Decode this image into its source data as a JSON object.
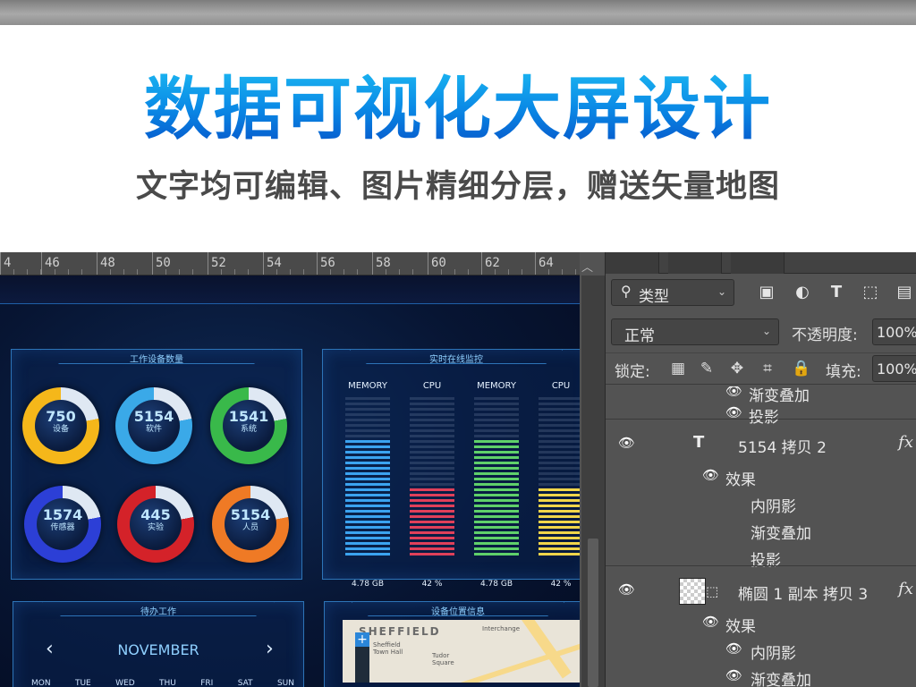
{
  "banner": {
    "title": "数据可视化大屏设计",
    "subtitle": "文字均可编辑、图片精细分层，赠送矢量地图"
  },
  "ruler": {
    "ticks": [
      "4",
      "46",
      "48",
      "50",
      "52",
      "54",
      "56",
      "58",
      "60",
      "62",
      "64"
    ]
  },
  "dashboard": {
    "panel_devices": {
      "title": "工作设备数量",
      "rings": [
        {
          "value": "750",
          "label": "设备",
          "color": "#f5b71a"
        },
        {
          "value": "5154",
          "label": "软件",
          "color": "#3aa9e8"
        },
        {
          "value": "1541",
          "label": "系统",
          "color": "#39b94a"
        },
        {
          "value": "1574",
          "label": "传感器",
          "color": "#2c3fd6"
        },
        {
          "value": "445",
          "label": "实验",
          "color": "#d42229"
        },
        {
          "value": "5154",
          "label": "人员",
          "color": "#ef7a25"
        }
      ]
    },
    "panel_monitor": {
      "title": "实时在线监控",
      "columns": [
        {
          "head": "MEMORY",
          "foot": "4.78 GB",
          "color": "#3ba3f0",
          "level": 0.72
        },
        {
          "head": "CPU",
          "foot": "42 %",
          "color": "#e0405a",
          "level": 0.42
        },
        {
          "head": "MEMORY",
          "foot": "4.78 GB",
          "color": "#5fd06a",
          "level": 0.72
        },
        {
          "head": "CPU",
          "foot": "42 %",
          "color": "#f1d54a",
          "level": 0.42
        }
      ]
    },
    "panel_calendar": {
      "title": "待办工作",
      "month": "NOVEMBER",
      "prev": "‹",
      "next": "›",
      "days": [
        "MON",
        "TUE",
        "WED",
        "THU",
        "FRI",
        "SAT",
        "SUN"
      ]
    },
    "panel_location": {
      "title": "设备位置信息",
      "map_name": "SHEFFIELD",
      "map_labels": [
        "Sheffield Town Hall",
        "Tudor Square",
        "Interchange"
      ],
      "zoom_in": "+"
    }
  },
  "layers_panel": {
    "filter_kind": "类型",
    "blend_mode": "正常",
    "opacity_label": "不透明度:",
    "opacity_value": "100%",
    "lock_label": "锁定:",
    "fill_label": "填充:",
    "fill_value": "100%",
    "rows": [
      {
        "text": "渐变叠加",
        "level": "effect"
      },
      {
        "text": "投影",
        "level": "effect"
      },
      {
        "text": "5154 拷贝 2",
        "level": "layer",
        "kind": "T",
        "fx": "fx"
      },
      {
        "text": "效果",
        "level": "group"
      },
      {
        "text": "内阴影",
        "level": "sub"
      },
      {
        "text": "渐变叠加",
        "level": "sub"
      },
      {
        "text": "投影",
        "level": "sub"
      },
      {
        "text": "椭圆 1 副本 拷贝 3",
        "level": "layer",
        "kind": "shape",
        "fx": "fx"
      },
      {
        "text": "效果",
        "level": "group"
      },
      {
        "text": "内阴影",
        "level": "sub"
      },
      {
        "text": "渐变叠加",
        "level": "sub"
      }
    ]
  }
}
